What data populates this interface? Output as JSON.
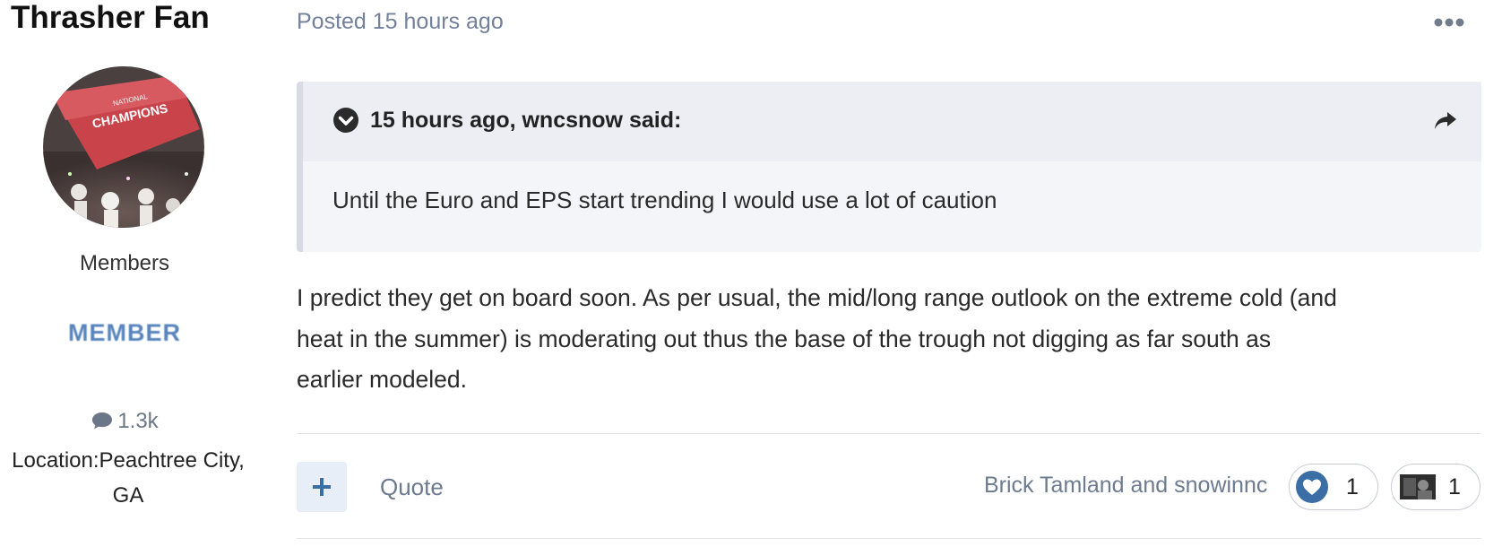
{
  "author": {
    "name": "Thrasher Fan",
    "avatar_text": [
      "NATIONAL",
      "CHAMPIONS"
    ],
    "group": "Members",
    "rank": "MEMBER",
    "post_count": "1.3k",
    "location_lines": [
      "Location:Peachtree City,",
      "GA"
    ]
  },
  "post": {
    "posted": "Posted 15 hours ago",
    "quote": {
      "citation": "15 hours ago, wncsnow said:",
      "text": "Until the Euro and EPS start trending I would use a lot of caution"
    },
    "body_lines": [
      "I predict they get on board soon. As per usual, the mid/long range outlook on the extreme cold (and",
      "heat in the summer) is moderating out thus the base of the trough not digging as far south as",
      "earlier modeled."
    ]
  },
  "actions": {
    "quote_label": "Quote",
    "reactors": "Brick Tamland and snowinnc",
    "reactions": [
      {
        "icon": "heart-icon",
        "count": "1"
      },
      {
        "icon": "image-reaction-icon",
        "count": "1"
      }
    ]
  },
  "colors": {
    "accent": "#3a6ea5",
    "muted_text": "#6d7b90",
    "quote_bg": "#f4f5f8"
  }
}
